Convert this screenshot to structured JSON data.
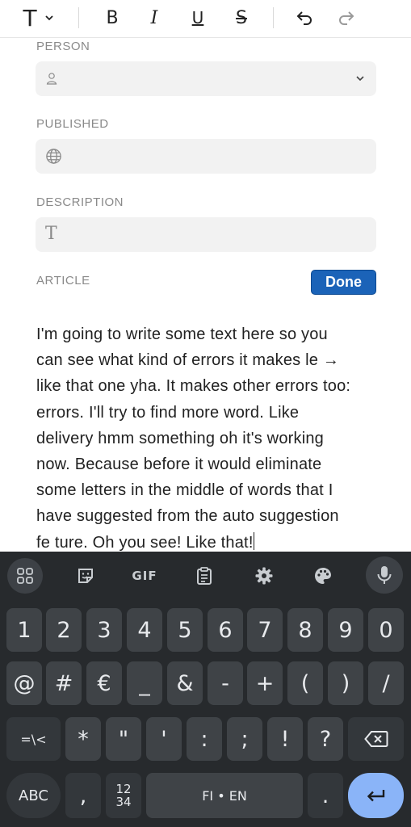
{
  "toolbar": {
    "items": [
      "text-style",
      "bold",
      "italic",
      "underline",
      "strikethrough",
      "undo",
      "redo"
    ],
    "text_style_glyph": "T",
    "bold_glyph": "B",
    "italic_glyph": "I",
    "underline_glyph": "U",
    "strike_glyph": "S"
  },
  "form": {
    "person": {
      "label": "PERSON",
      "value": ""
    },
    "published": {
      "label": "PUBLISHED",
      "value": ""
    },
    "description": {
      "label": "DESCRIPTION",
      "placeholder_glyph": "T"
    },
    "article": {
      "label": "ARTICLE",
      "done_label": "Done",
      "lines": [
        "I'm going to write some text here so you",
        "can see what kind of errors it makes le →",
        "like that one yha. It makes other errors too:",
        "errors. I'll try to find more word. Like",
        "delivery hmm something oh it's working",
        "now. Because before it would eliminate",
        "some letters in the middle of words that I",
        "have suggested from the auto suggestion",
        "fe ture. Oh you see! Like that!"
      ]
    }
  },
  "keyboard": {
    "top_row": [
      "apps-icon",
      "sticker-icon",
      "GIF",
      "clipboard-icon",
      "settings-icon",
      "palette-icon",
      "mic-icon"
    ],
    "gif_label": "GIF",
    "row1": [
      "1",
      "2",
      "3",
      "4",
      "5",
      "6",
      "7",
      "8",
      "9",
      "0"
    ],
    "row2": [
      "@",
      "#",
      "€",
      "_",
      "&",
      "-",
      "+",
      "(",
      ")",
      "/"
    ],
    "row3": [
      "=\\<",
      "*",
      "\"",
      "'",
      ":",
      ";",
      "!",
      "?"
    ],
    "row4": {
      "abc": "ABC",
      "comma": ",",
      "numpad_top": "12",
      "numpad_bottom": "34",
      "space": "FI • EN",
      "period": "."
    },
    "colors": {
      "background": "#272a2d",
      "key": "#3f4347",
      "enter": "#8ab4f8",
      "accent": "#1b63b8"
    }
  }
}
